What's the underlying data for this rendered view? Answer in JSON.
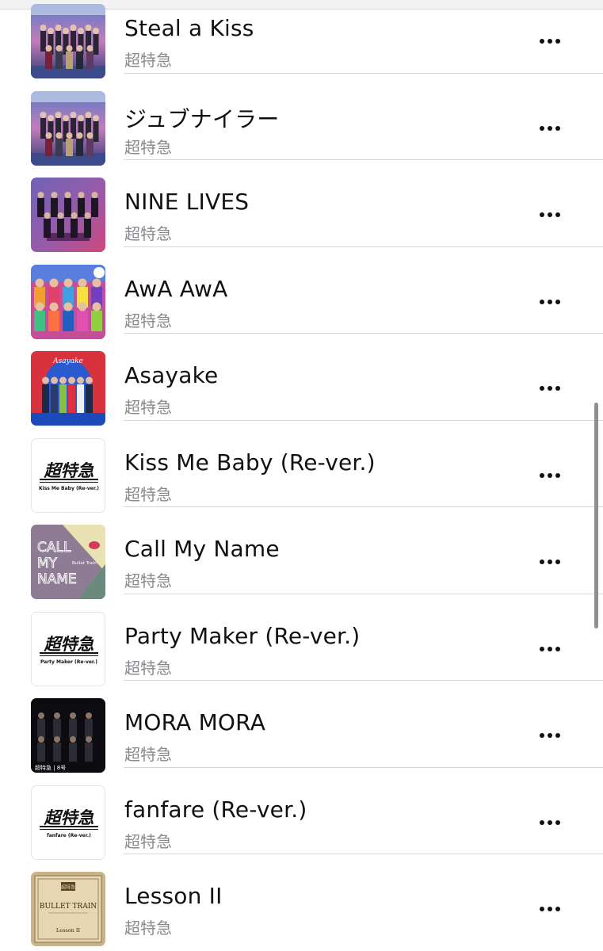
{
  "songs": [
    {
      "title": "Steal a Kiss",
      "artist": "超特急",
      "artwork": "photo-city-group"
    },
    {
      "title": "ジュブナイラー",
      "artist": "超特急",
      "artwork": "photo-city-group"
    },
    {
      "title": "NINE LIVES",
      "artist": "超特急",
      "artwork": "photo-purple-group"
    },
    {
      "title": "AwA AwA",
      "artist": "超特急",
      "artwork": "photo-colorful-group"
    },
    {
      "title": "Asayake",
      "artist": "超特急",
      "artwork": "photo-red-arch-group",
      "artwork_text": "Asayake"
    },
    {
      "title": "Kiss Me Baby (Re-ver.)",
      "artist": "超特急",
      "artwork": "logo-cover",
      "logo": "超特急",
      "caption": "Kiss Me Baby (Re-ver.)"
    },
    {
      "title": "Call My Name",
      "artist": "超特急",
      "artwork": "call-my-name-cover",
      "cover_words": [
        "CALL",
        "MY",
        "NAME"
      ],
      "cover_small": "Bullet Train"
    },
    {
      "title": "Party Maker (Re-ver.)",
      "artist": "超特急",
      "artwork": "logo-cover",
      "logo": "超特急",
      "caption": "Party Maker (Re-ver.)"
    },
    {
      "title": "MORA MORA",
      "artist": "超特急",
      "artwork": "photo-dark-group",
      "artwork_text": "超特急 | 8号"
    },
    {
      "title": "fanfare (Re-ver.)",
      "artist": "超特急",
      "artwork": "logo-cover",
      "logo": "超特急",
      "caption": "fanfare (Re-ver.)"
    },
    {
      "title": "Lesson II",
      "artist": "超特急",
      "artwork": "parchment-cover",
      "cover_badge": "超特急",
      "cover_title": "BULLET TRAIN",
      "cover_subtitle": "Lesson II"
    }
  ],
  "icons": {
    "more": "ellipsis-icon"
  },
  "colors": {
    "text": "#111111",
    "secondary": "#8a8a8e",
    "divider": "#d6d6d9",
    "scrollbar": "#8e8e93"
  }
}
